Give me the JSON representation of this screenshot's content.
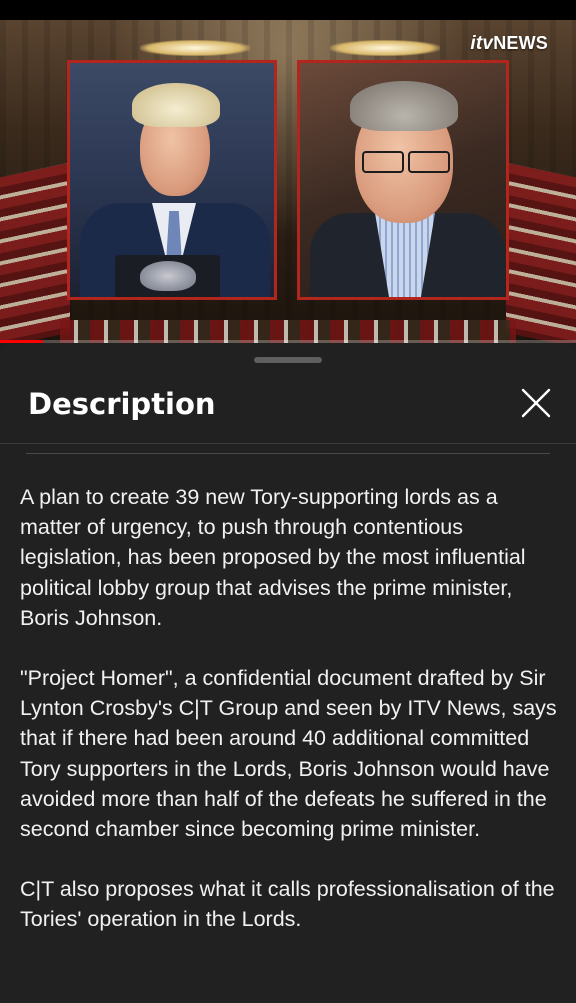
{
  "video": {
    "channel_logo_itv": "itv",
    "channel_logo_news": "NEWS",
    "progress_fraction": 0.075,
    "progress_color": "#ff0000",
    "frame_color": "#b3261e"
  },
  "sheet": {
    "title": "Description",
    "close_icon": "close-icon",
    "paragraphs": [
      "A plan to create 39 new Tory-supporting lords as a matter of urgency, to push through contentious legislation, has been proposed by the most influential political lobby group that advises the prime minister, Boris Johnson.",
      "\"Project Homer\", a confidential document drafted by Sir Lynton Crosby's C|T Group and seen by ITV News, says that if there had been around 40 additional committed Tory supporters in the Lords, Boris Johnson would have avoided more than half of the defeats he suffered in the second chamber since becoming prime minister.",
      "C|T also proposes what it calls professionalisation of the Tories' operation in the Lords."
    ]
  }
}
